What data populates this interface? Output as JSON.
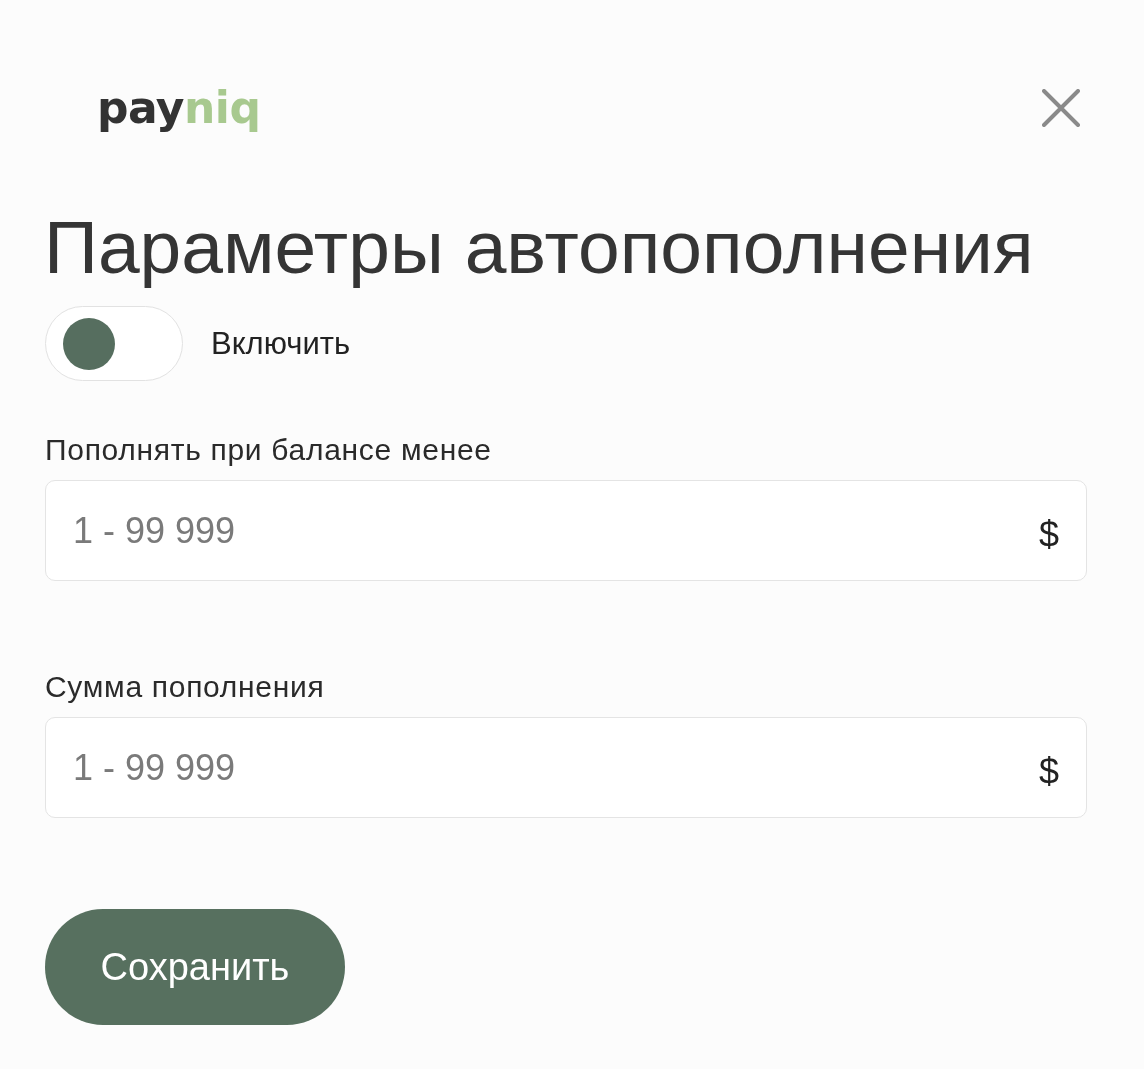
{
  "logo": {
    "parts": [
      "pay",
      "niq"
    ]
  },
  "title": "Параметры автопополнения",
  "toggle": {
    "label": "Включить",
    "on": false
  },
  "fields": [
    {
      "label": "Пополнять при балансе менее",
      "placeholder": "1 - 99 999",
      "suffix": "$"
    },
    {
      "label": "Сумма пополнения",
      "placeholder": "1 - 99 999",
      "suffix": "$"
    }
  ],
  "save_button": {
    "label": "Сохранить"
  }
}
